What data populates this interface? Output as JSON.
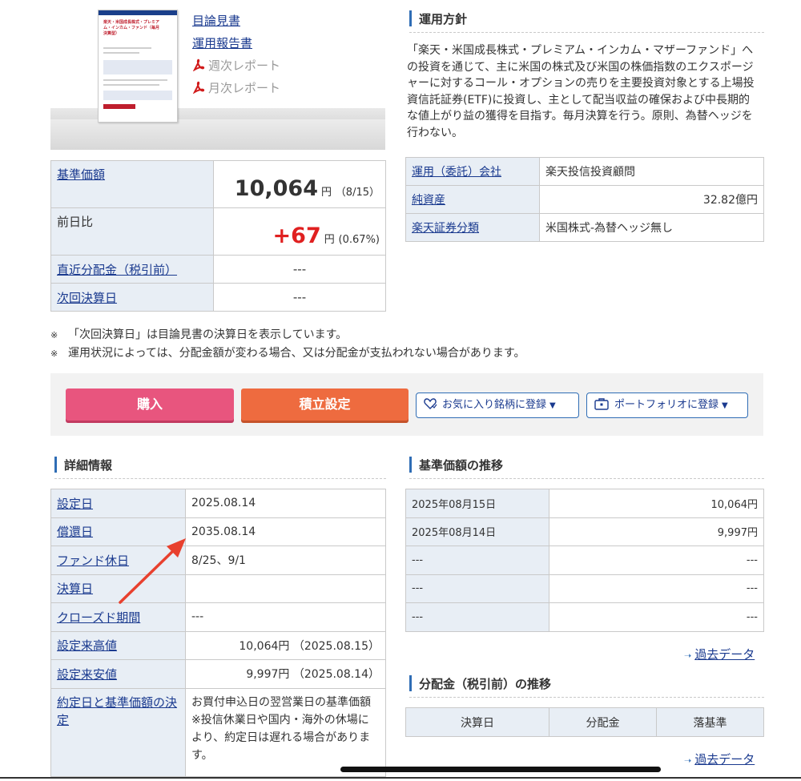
{
  "brochure": {
    "title": "楽天・米国成長株式・プレミアム・インカム・ファンド（毎月決算型）"
  },
  "doc_links": {
    "prospectus": "目論見書",
    "operation_report": "運用報告書",
    "weekly_report": "週次レポート",
    "monthly_report": "月次レポート"
  },
  "price": {
    "nav_label": "基準価額",
    "nav_value": "10,064",
    "nav_unit": "円",
    "nav_date": "（8/15）",
    "change_label": "前日比",
    "change_value": "+67",
    "change_unit": "円",
    "change_pct": "(0.67%)",
    "last_dist_label": "直近分配金（税引前）",
    "last_dist_value": "---",
    "next_settle_label": "次回決算日",
    "next_settle_value": "---"
  },
  "policy": {
    "heading": "運用方針",
    "text": "「楽天・米国成長株式・プレミアム・インカム・マザーファンド」への投資を通じて、主に米国の株式及び米国の株価指数のエクスポージャーに対するコール・オプションの売りを主要投資対象とする上場投資信託証券(ETF)に投資し、主として配当収益の確保および中長期的な値上がり益の獲得を目指す。毎月決算を行う。原則、為替ヘッジを行わない。"
  },
  "fund_info": [
    {
      "label": "運用（委託）会社",
      "value": "楽天投信投資顧問",
      "align": "left"
    },
    {
      "label": "純資産",
      "value": "32.82億円",
      "align": "right"
    },
    {
      "label": "楽天証券分類",
      "value": "米国株式-為替ヘッジ無し",
      "align": "left"
    }
  ],
  "notes": {
    "mark": "※",
    "note1": "「次回決算日」は目論見書の決算日を表示しています。",
    "note2": "運用状況によっては、分配金額が変わる場合、又は分配金が支払われない場合があります。"
  },
  "actions": {
    "buy": "購入",
    "accumulate": "積立設定",
    "favorite": "お気に入り銘柄に登録",
    "portfolio": "ポートフォリオに登録",
    "caret": "▼"
  },
  "details": {
    "heading": "詳細情報",
    "rows": [
      {
        "label": "設定日",
        "value": "2025.08.14"
      },
      {
        "label": "償還日",
        "value": "2035.08.14"
      },
      {
        "label": "ファンド休日",
        "value": "8/25、9/1"
      },
      {
        "label": "決算日",
        "value": ""
      },
      {
        "label": "クローズド期間",
        "value": "---"
      },
      {
        "label": "設定来高値",
        "value": "10,064円 （2025.08.15）"
      },
      {
        "label": "設定来安値",
        "value": "9,997円 （2025.08.14）"
      },
      {
        "label": "約定日と基準価額の決定",
        "value": "お買付申込日の翌営業日の基準価額",
        "value2": "※投信休業日や国内・海外の休場により、約定日は遅れる場合があります。"
      }
    ]
  },
  "nav_history": {
    "heading": "基準価額の推移",
    "rows": [
      {
        "date": "2025年08月15日",
        "value": "10,064円"
      },
      {
        "date": "2025年08月14日",
        "value": "9,997円"
      },
      {
        "date": "---",
        "value": "---"
      },
      {
        "date": "---",
        "value": "---"
      },
      {
        "date": "---",
        "value": "---"
      }
    ],
    "past_link": "過去データ",
    "arrow": "➝"
  },
  "distribution": {
    "heading": "分配金（税引前）の推移",
    "col1": "決算日",
    "col2": "分配金",
    "col3": "落基準",
    "past_link": "過去データ"
  },
  "colors": {
    "buy_button": "#e8557e",
    "accumulate_button": "#ee6b3f",
    "change_positive": "#e02020",
    "link": "#1a3a8f",
    "label_bg": "#e8eef5",
    "annotation_arrow": "#e8402e"
  }
}
